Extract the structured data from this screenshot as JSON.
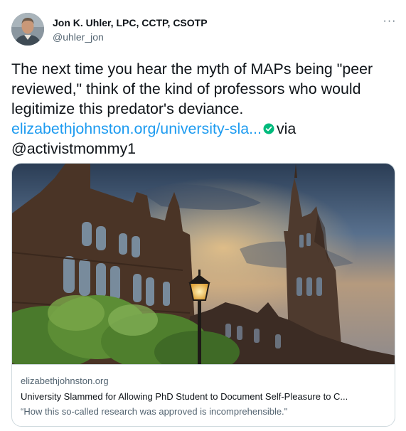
{
  "author": {
    "display_name": "Jon K. Uhler, LPC, CCTP, CSOTP",
    "handle": "@uhler_jon",
    "avatar_icon": "user-photo-avatar"
  },
  "more_icon": "more-options-icon",
  "more_glyph": "···",
  "tweet": {
    "line1": "The next time you hear the myth of MAPs being \"peer",
    "line2": "reviewed,\" think of the kind of professors who would",
    "line3": "legitimize this predator's deviance.",
    "link_text": "elizabethjohnston.org/university-sla...",
    "verified_icon": "verified-check-icon",
    "via_text": "via",
    "mention": "@activistmommy1"
  },
  "card": {
    "image_icon": "university-building-photo",
    "domain": "elizabethjohnston.org",
    "title": "University Slammed for Allowing PhD Student to Document Self-Pleasure to C...",
    "description": "“How this so-called research was approved is incomprehensible.\""
  },
  "colors": {
    "link": "#1d9bf0",
    "verified": "#00ba7c",
    "secondary_text": "#536471",
    "border": "#cfd9de"
  }
}
